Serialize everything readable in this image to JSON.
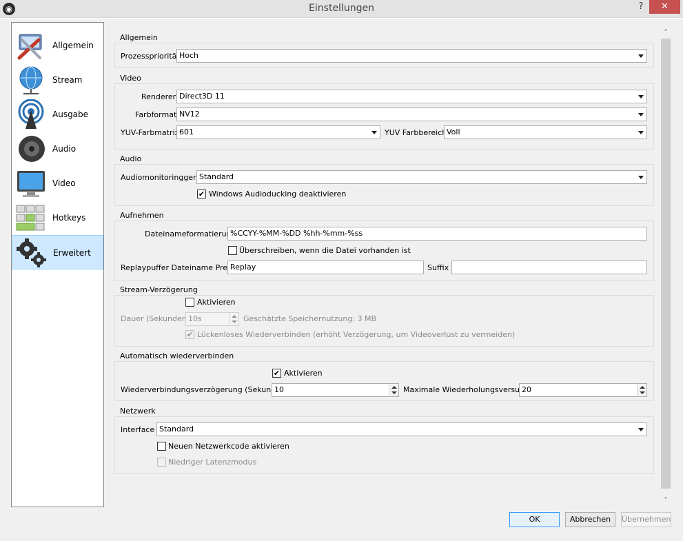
{
  "window": {
    "title": "Einstellungen",
    "help_label": "?",
    "close_label": "✕",
    "app_icon_glyph": "◉"
  },
  "sidebar": {
    "items": [
      {
        "label": "Allgemein",
        "icon": "wrench-screwdriver-icon"
      },
      {
        "label": "Stream",
        "icon": "globe-network-icon"
      },
      {
        "label": "Ausgabe",
        "icon": "broadcast-tower-icon"
      },
      {
        "label": "Audio",
        "icon": "speaker-icon"
      },
      {
        "label": "Video",
        "icon": "monitor-icon"
      },
      {
        "label": "Hotkeys",
        "icon": "keyboard-icon"
      },
      {
        "label": "Erweitert",
        "icon": "gears-icon",
        "selected": true
      }
    ]
  },
  "general": {
    "title": "Allgemein",
    "priority_label": "Prozesspriorität",
    "priority_value": "Hoch"
  },
  "video": {
    "title": "Video",
    "renderer_label": "Renderer",
    "renderer_value": "Direct3D 11",
    "color_format_label": "Farbformat",
    "color_format_value": "NV12",
    "yuv_matrix_label": "YUV-Farbmatrix",
    "yuv_matrix_value": "601",
    "yuv_range_label": "YUV Farbbereich",
    "yuv_range_value": "Voll"
  },
  "audio": {
    "title": "Audio",
    "monitoring_label": "Audiomonitoringgerät",
    "monitoring_value": "Standard",
    "ducking_label": "Windows Audioducking deaktivieren",
    "ducking_checked": true
  },
  "recording": {
    "title": "Aufnehmen",
    "filename_label": "Dateinameformatierung",
    "filename_value": "%CCYY-%MM-%DD %hh-%mm-%ss",
    "overwrite_label": "Überschreiben, wenn die Datei vorhanden ist",
    "overwrite_checked": false,
    "replay_prefix_label": "Replaypuffer Dateiname Prefix",
    "replay_prefix_value": "Replay",
    "suffix_label": "Suffix",
    "suffix_value": ""
  },
  "stream_delay": {
    "title": "Stream-Verzögerung",
    "enable_label": "Aktivieren",
    "enable_checked": false,
    "duration_label": "Dauer (Sekunden)",
    "duration_value": "10s",
    "memory_label": "Geschätzte Speichernutzung: 3 MB",
    "preserve_label": "Lückenloses Wiederverbinden (erhöht Verzögerung, um Videoverlust zu vermeiden)",
    "preserve_checked": true
  },
  "reconnect": {
    "title": "Automatisch wiederverbinden",
    "enable_label": "Aktivieren",
    "enable_checked": true,
    "delay_label": "Wiederverbindungsverzögerung (Sekunden)",
    "delay_value": "10",
    "max_retries_label": "Maximale Wiederholungsversuche",
    "max_retries_value": "20"
  },
  "network": {
    "title": "Netzwerk",
    "interface_label": "Interface",
    "interface_value": "Standard",
    "new_code_label": "Neuen Netzwerkcode aktivieren",
    "new_code_checked": false,
    "low_latency_label": "Niedriger Latenzmodus",
    "low_latency_checked": false
  },
  "buttons": {
    "ok": "OK",
    "cancel": "Abbrechen",
    "apply": "Übernehmen"
  },
  "check_glyph": "✔",
  "scroll": {
    "up": "˄",
    "down": "˅"
  },
  "colors": {
    "selection_bg": "#cde8ff",
    "selection_border": "#99d1ff",
    "close_red": "#c75050",
    "default_button_border": "#3399ff"
  }
}
